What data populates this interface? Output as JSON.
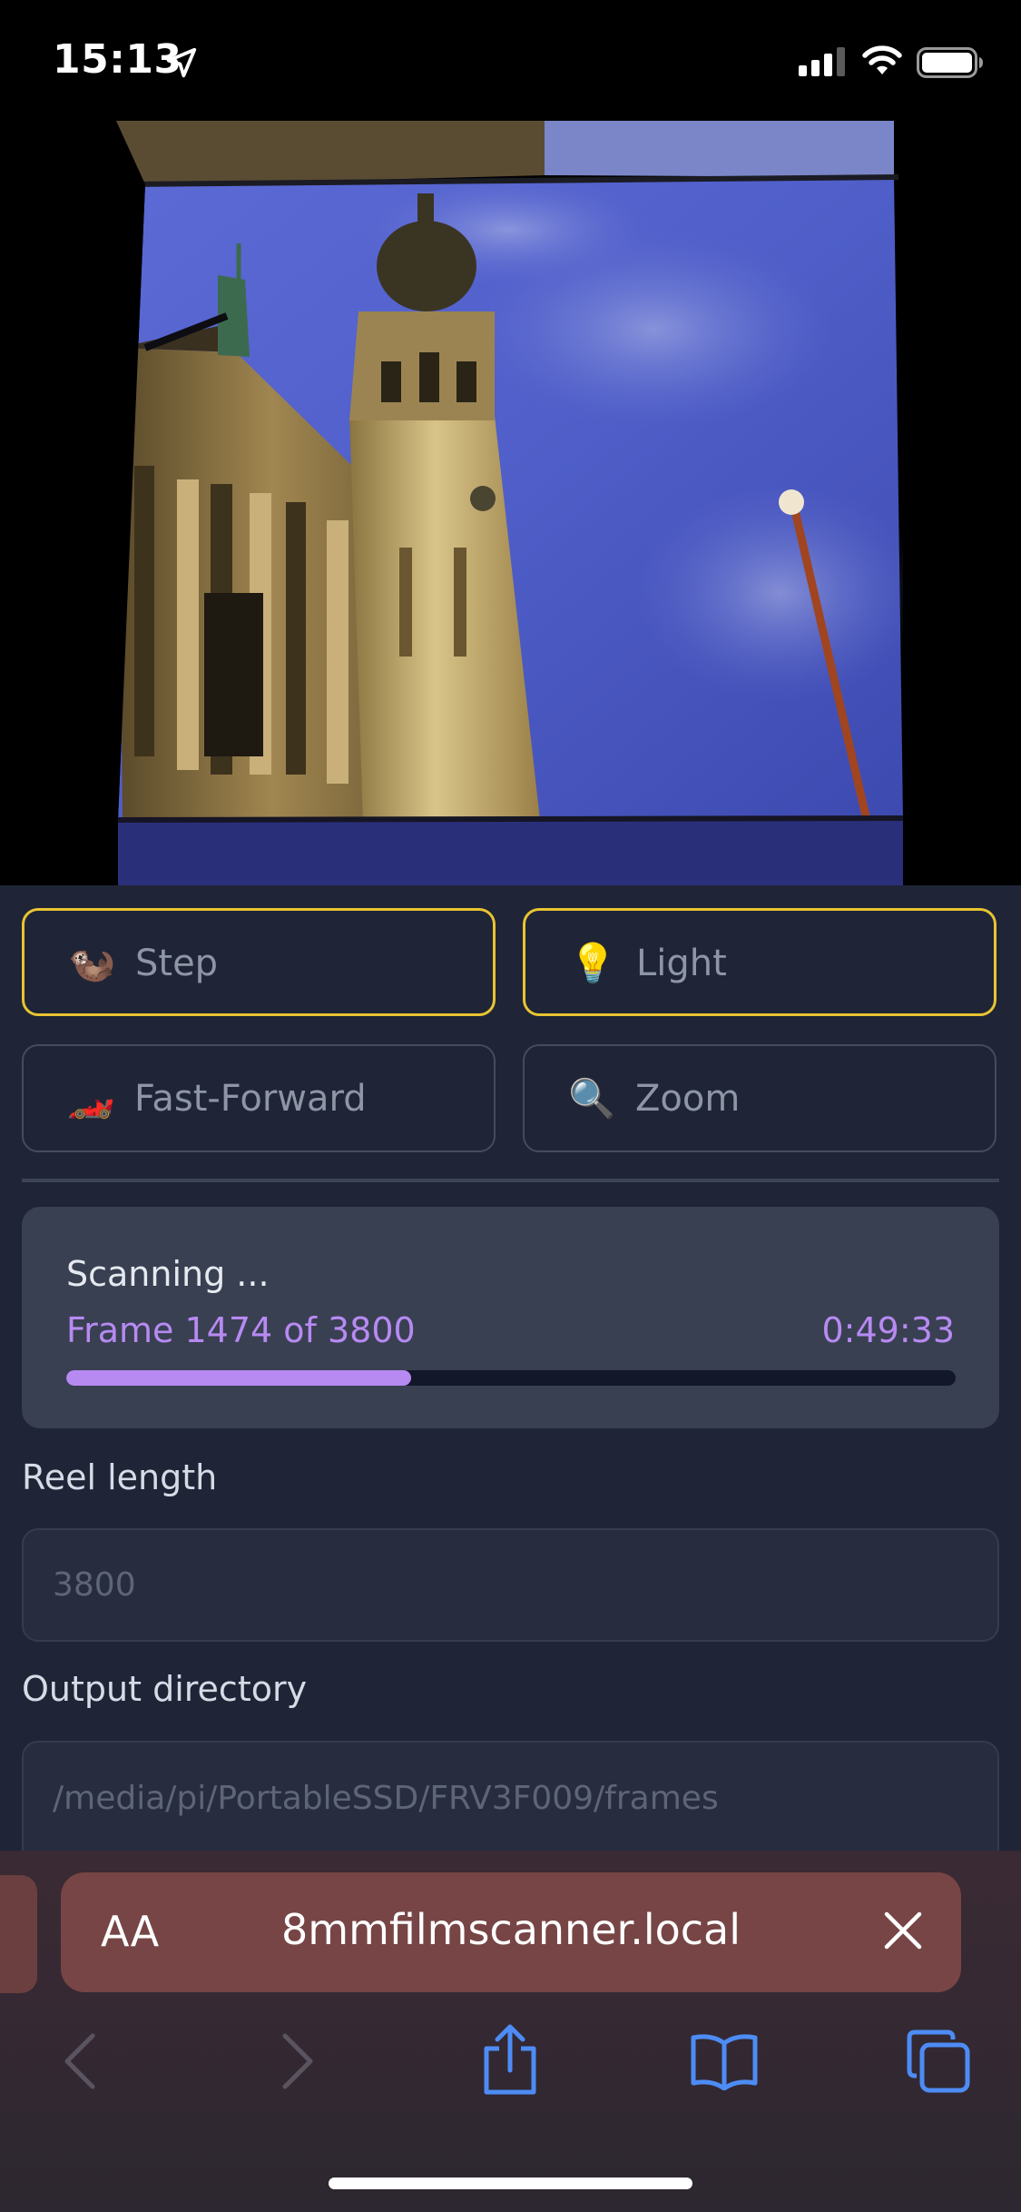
{
  "status_bar": {
    "time": "15:13"
  },
  "controls": [
    {
      "emoji": "🦦",
      "label": "Step",
      "active": true
    },
    {
      "emoji": "💡",
      "label": "Light",
      "active": true
    },
    {
      "emoji": "🏎️",
      "label": "Fast-Forward",
      "active": false
    },
    {
      "emoji": "🔍",
      "label": "Zoom",
      "active": false
    }
  ],
  "scan": {
    "title": "Scanning ...",
    "frame_text": "Frame 1474 of 3800",
    "elapsed": "0:49:33",
    "progress": 0.388
  },
  "fields": {
    "reel_length": {
      "label": "Reel length",
      "placeholder": "3800"
    },
    "output_directory": {
      "label": "Output directory",
      "placeholder": "/media/pi/PortableSSD/FRV3F009/frames"
    }
  },
  "browser": {
    "aa_label": "AA",
    "url": "8mmfilmscanner.local"
  },
  "colors": {
    "accent": "#b78af2",
    "active_border": "#e8c431",
    "background": "#1f2536"
  }
}
